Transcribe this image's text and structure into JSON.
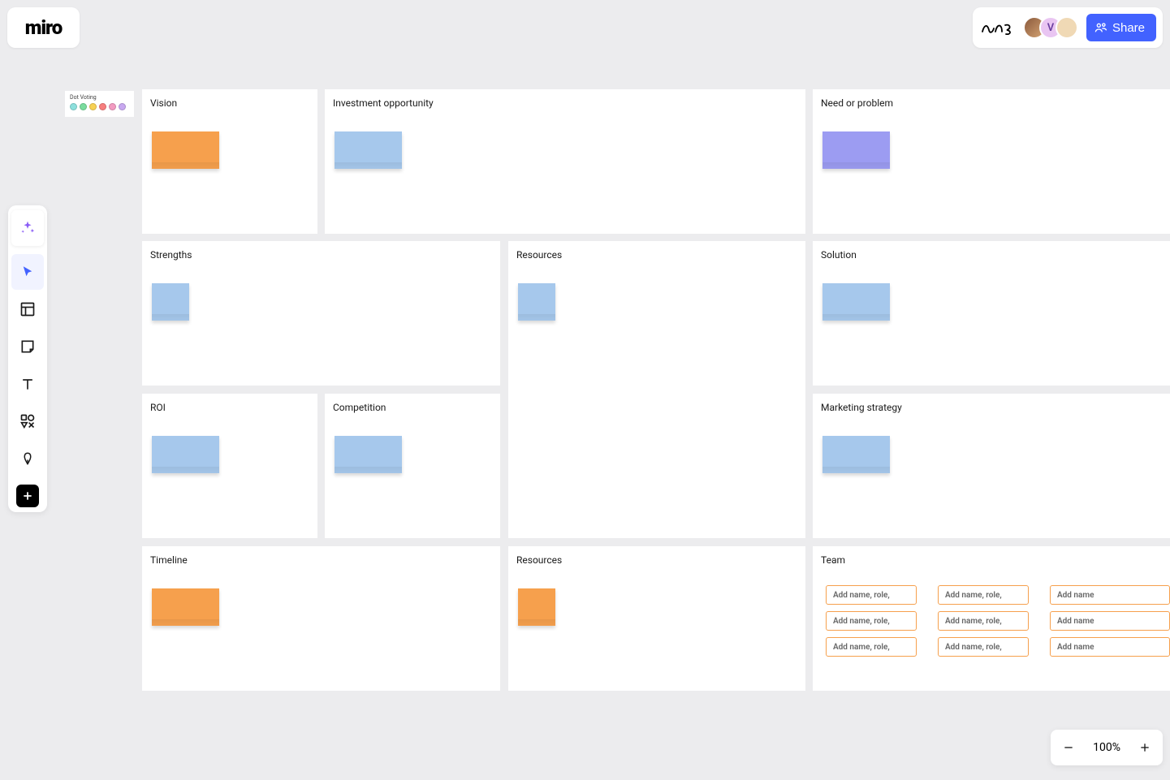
{
  "logo": "miro",
  "share_label": "Share",
  "avatars": {
    "v_letter": "V"
  },
  "dot_voting": {
    "title": "Dot Voting",
    "colors": [
      "#8de0dd",
      "#7adc9e",
      "#f7d154",
      "#f77e7e",
      "#f29bc1",
      "#c8a8f0"
    ]
  },
  "panels": {
    "vision": "Vision",
    "investment": "Investment opportunity",
    "need": "Need or problem",
    "strengths": "Strengths",
    "resources1": "Resources",
    "solution": "Solution",
    "roi": "ROI",
    "competition": "Competition",
    "marketing": "Marketing strategy",
    "timeline": "Timeline",
    "resources2": "Resources",
    "team": "Team"
  },
  "team_placeholder": "Add name, role,",
  "team_placeholder_cut": "Add name",
  "zoom": "100%"
}
